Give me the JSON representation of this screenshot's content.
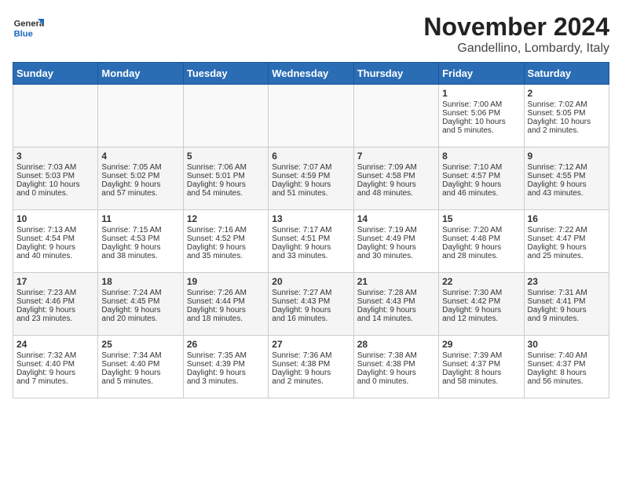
{
  "logo": {
    "general": "General",
    "blue": "Blue"
  },
  "title": "November 2024",
  "subtitle": "Gandellino, Lombardy, Italy",
  "weekdays": [
    "Sunday",
    "Monday",
    "Tuesday",
    "Wednesday",
    "Thursday",
    "Friday",
    "Saturday"
  ],
  "weeks": [
    [
      {
        "day": "",
        "info": ""
      },
      {
        "day": "",
        "info": ""
      },
      {
        "day": "",
        "info": ""
      },
      {
        "day": "",
        "info": ""
      },
      {
        "day": "",
        "info": ""
      },
      {
        "day": "1",
        "info": "Sunrise: 7:00 AM\nSunset: 5:06 PM\nDaylight: 10 hours\nand 5 minutes."
      },
      {
        "day": "2",
        "info": "Sunrise: 7:02 AM\nSunset: 5:05 PM\nDaylight: 10 hours\nand 2 minutes."
      }
    ],
    [
      {
        "day": "3",
        "info": "Sunrise: 7:03 AM\nSunset: 5:03 PM\nDaylight: 10 hours\nand 0 minutes."
      },
      {
        "day": "4",
        "info": "Sunrise: 7:05 AM\nSunset: 5:02 PM\nDaylight: 9 hours\nand 57 minutes."
      },
      {
        "day": "5",
        "info": "Sunrise: 7:06 AM\nSunset: 5:01 PM\nDaylight: 9 hours\nand 54 minutes."
      },
      {
        "day": "6",
        "info": "Sunrise: 7:07 AM\nSunset: 4:59 PM\nDaylight: 9 hours\nand 51 minutes."
      },
      {
        "day": "7",
        "info": "Sunrise: 7:09 AM\nSunset: 4:58 PM\nDaylight: 9 hours\nand 48 minutes."
      },
      {
        "day": "8",
        "info": "Sunrise: 7:10 AM\nSunset: 4:57 PM\nDaylight: 9 hours\nand 46 minutes."
      },
      {
        "day": "9",
        "info": "Sunrise: 7:12 AM\nSunset: 4:55 PM\nDaylight: 9 hours\nand 43 minutes."
      }
    ],
    [
      {
        "day": "10",
        "info": "Sunrise: 7:13 AM\nSunset: 4:54 PM\nDaylight: 9 hours\nand 40 minutes."
      },
      {
        "day": "11",
        "info": "Sunrise: 7:15 AM\nSunset: 4:53 PM\nDaylight: 9 hours\nand 38 minutes."
      },
      {
        "day": "12",
        "info": "Sunrise: 7:16 AM\nSunset: 4:52 PM\nDaylight: 9 hours\nand 35 minutes."
      },
      {
        "day": "13",
        "info": "Sunrise: 7:17 AM\nSunset: 4:51 PM\nDaylight: 9 hours\nand 33 minutes."
      },
      {
        "day": "14",
        "info": "Sunrise: 7:19 AM\nSunset: 4:49 PM\nDaylight: 9 hours\nand 30 minutes."
      },
      {
        "day": "15",
        "info": "Sunrise: 7:20 AM\nSunset: 4:48 PM\nDaylight: 9 hours\nand 28 minutes."
      },
      {
        "day": "16",
        "info": "Sunrise: 7:22 AM\nSunset: 4:47 PM\nDaylight: 9 hours\nand 25 minutes."
      }
    ],
    [
      {
        "day": "17",
        "info": "Sunrise: 7:23 AM\nSunset: 4:46 PM\nDaylight: 9 hours\nand 23 minutes."
      },
      {
        "day": "18",
        "info": "Sunrise: 7:24 AM\nSunset: 4:45 PM\nDaylight: 9 hours\nand 20 minutes."
      },
      {
        "day": "19",
        "info": "Sunrise: 7:26 AM\nSunset: 4:44 PM\nDaylight: 9 hours\nand 18 minutes."
      },
      {
        "day": "20",
        "info": "Sunrise: 7:27 AM\nSunset: 4:43 PM\nDaylight: 9 hours\nand 16 minutes."
      },
      {
        "day": "21",
        "info": "Sunrise: 7:28 AM\nSunset: 4:43 PM\nDaylight: 9 hours\nand 14 minutes."
      },
      {
        "day": "22",
        "info": "Sunrise: 7:30 AM\nSunset: 4:42 PM\nDaylight: 9 hours\nand 12 minutes."
      },
      {
        "day": "23",
        "info": "Sunrise: 7:31 AM\nSunset: 4:41 PM\nDaylight: 9 hours\nand 9 minutes."
      }
    ],
    [
      {
        "day": "24",
        "info": "Sunrise: 7:32 AM\nSunset: 4:40 PM\nDaylight: 9 hours\nand 7 minutes."
      },
      {
        "day": "25",
        "info": "Sunrise: 7:34 AM\nSunset: 4:40 PM\nDaylight: 9 hours\nand 5 minutes."
      },
      {
        "day": "26",
        "info": "Sunrise: 7:35 AM\nSunset: 4:39 PM\nDaylight: 9 hours\nand 3 minutes."
      },
      {
        "day": "27",
        "info": "Sunrise: 7:36 AM\nSunset: 4:38 PM\nDaylight: 9 hours\nand 2 minutes."
      },
      {
        "day": "28",
        "info": "Sunrise: 7:38 AM\nSunset: 4:38 PM\nDaylight: 9 hours\nand 0 minutes."
      },
      {
        "day": "29",
        "info": "Sunrise: 7:39 AM\nSunset: 4:37 PM\nDaylight: 8 hours\nand 58 minutes."
      },
      {
        "day": "30",
        "info": "Sunrise: 7:40 AM\nSunset: 4:37 PM\nDaylight: 8 hours\nand 56 minutes."
      }
    ]
  ]
}
